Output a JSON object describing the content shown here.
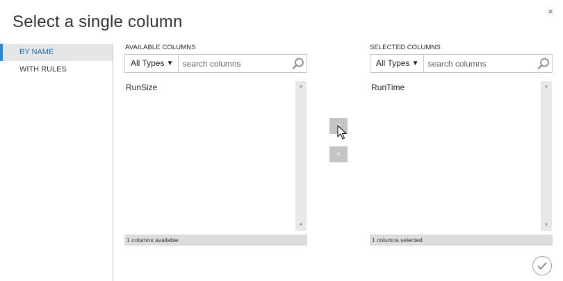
{
  "dialog": {
    "title": "Select a single column",
    "close_glyph": "×"
  },
  "sidebar": {
    "items": [
      {
        "label": "BY NAME",
        "active": true
      },
      {
        "label": "WITH RULES",
        "active": false
      }
    ]
  },
  "available": {
    "header": "AVAILABLE COLUMNS",
    "type_filter": "All Types",
    "search_placeholder": "search columns",
    "items": [
      "RunSize"
    ],
    "footer": "1 columns available"
  },
  "selected": {
    "header": "SELECTED COLUMNS",
    "type_filter": "All Types",
    "search_placeholder": "search columns",
    "items": [
      "RunTime"
    ],
    "footer": "1 columns selected"
  },
  "actions": {
    "add_glyph": ">",
    "remove_glyph": "<"
  },
  "icons": {
    "search": "search-icon",
    "ok": "checkmark-icon",
    "close": "close-icon",
    "caret": "caret-down-icon"
  },
  "colors": {
    "accent": "#2b88d8",
    "active_bg": "#e6e6e6",
    "button_bg": "#c4c4c4"
  }
}
